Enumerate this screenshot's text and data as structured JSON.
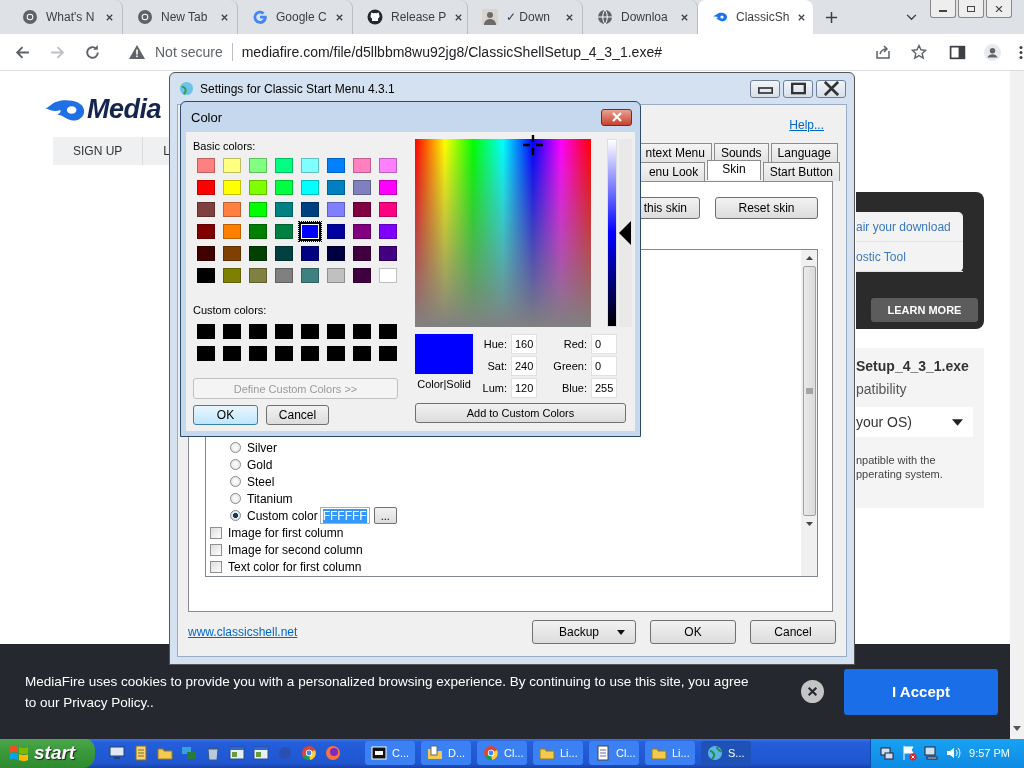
{
  "browser": {
    "tabs": [
      {
        "kind": "chrome",
        "title": "What's N",
        "selected": false
      },
      {
        "kind": "chrome",
        "title": "New Tab",
        "selected": false
      },
      {
        "kind": "g",
        "title": "Google C",
        "selected": false
      },
      {
        "kind": "github",
        "title": "Release P",
        "selected": false
      },
      {
        "kind": "avatar",
        "title": "✓ Down",
        "selected": false
      },
      {
        "kind": "globe",
        "title": "Downloa",
        "selected": false
      },
      {
        "kind": "flame",
        "title": "ClassicSh",
        "selected": true
      }
    ],
    "security": "Not secure",
    "url": "mediafire.com/file/d5llbbm8wu92jg8/ClassicShellSetup_4_3_1.exe#"
  },
  "page": {
    "logo": "Media",
    "nav": [
      "SIGN UP",
      "L"
    ],
    "help_links": [
      "air your download",
      "ostic Tool"
    ],
    "learn_more": "LEARN MORE",
    "file_name": "Setup_4_3_1.exe",
    "compat_label": "patibility",
    "os_select": "your OS)",
    "note": [
      "npatible with the",
      "pperating system."
    ],
    "cookie_text": "MediaFire uses cookies to provide you with a personalized browsing experience. By continuing to use this site, you agree to our Privacy Policy..",
    "cookie_button": "I Accept"
  },
  "settings_dialog": {
    "title": "Settings for Classic Start Menu 4.3.1",
    "help": "Help...",
    "tab_rows": [
      [
        {
          "label": "ntext Menu",
          "selected": false
        },
        {
          "label": "Sounds",
          "selected": false
        },
        {
          "label": "Language",
          "selected": false
        }
      ],
      [
        {
          "label": "enu Look",
          "selected": false
        },
        {
          "label": "Skin",
          "selected": true
        },
        {
          "label": "Start Button",
          "selected": false
        }
      ]
    ],
    "skin_buttons": [
      "this skin",
      "Reset skin"
    ],
    "options": [
      {
        "kind": "radio",
        "label": "Silver",
        "selected": false
      },
      {
        "kind": "radio",
        "label": "Gold",
        "selected": false
      },
      {
        "kind": "radio",
        "label": "Steel",
        "selected": false
      },
      {
        "kind": "radio",
        "label": "Titanium",
        "selected": false
      },
      {
        "kind": "radio",
        "label": "Custom color",
        "selected": true,
        "value": "FFFFFF",
        "button": "..."
      },
      {
        "kind": "checkbox",
        "label": "Image for first column",
        "checked": false
      },
      {
        "kind": "checkbox",
        "label": "Image for second column",
        "checked": false
      },
      {
        "kind": "checkbox",
        "label": "Text color for first column",
        "checked": false
      }
    ],
    "link": "www.classicshell.net",
    "buttons": [
      {
        "label": "Backup",
        "dropdown": true
      },
      {
        "label": "OK",
        "dropdown": false
      },
      {
        "label": "Cancel",
        "dropdown": false
      }
    ]
  },
  "color_dialog": {
    "title": "Color",
    "basic_label": "Basic colors:",
    "basic_colors": [
      {
        "color": "#ff8080",
        "selected": false
      },
      {
        "color": "#ffff80",
        "selected": false
      },
      {
        "color": "#80ff80",
        "selected": false
      },
      {
        "color": "#00ff80",
        "selected": false
      },
      {
        "color": "#80ffff",
        "selected": false
      },
      {
        "color": "#0080ff",
        "selected": false
      },
      {
        "color": "#ff80c0",
        "selected": false
      },
      {
        "color": "#ff80ff",
        "selected": false
      },
      {
        "color": "#ff0000",
        "selected": false
      },
      {
        "color": "#ffff00",
        "selected": false
      },
      {
        "color": "#80ff00",
        "selected": false
      },
      {
        "color": "#00ff40",
        "selected": false
      },
      {
        "color": "#00ffff",
        "selected": false
      },
      {
        "color": "#0080c0",
        "selected": false
      },
      {
        "color": "#8080c0",
        "selected": false
      },
      {
        "color": "#ff00ff",
        "selected": false
      },
      {
        "color": "#804040",
        "selected": false
      },
      {
        "color": "#ff8040",
        "selected": false
      },
      {
        "color": "#00ff00",
        "selected": false
      },
      {
        "color": "#008080",
        "selected": false
      },
      {
        "color": "#004080",
        "selected": false
      },
      {
        "color": "#8080ff",
        "selected": false
      },
      {
        "color": "#800040",
        "selected": false
      },
      {
        "color": "#ff0080",
        "selected": false
      },
      {
        "color": "#800000",
        "selected": false
      },
      {
        "color": "#ff8000",
        "selected": false
      },
      {
        "color": "#008000",
        "selected": false
      },
      {
        "color": "#008040",
        "selected": false
      },
      {
        "color": "#0000ff",
        "selected": true
      },
      {
        "color": "#0000a0",
        "selected": false
      },
      {
        "color": "#800080",
        "selected": false
      },
      {
        "color": "#8000ff",
        "selected": false
      },
      {
        "color": "#400000",
        "selected": false
      },
      {
        "color": "#804000",
        "selected": false
      },
      {
        "color": "#004000",
        "selected": false
      },
      {
        "color": "#004040",
        "selected": false
      },
      {
        "color": "#000080",
        "selected": false
      },
      {
        "color": "#000040",
        "selected": false
      },
      {
        "color": "#400040",
        "selected": false
      },
      {
        "color": "#400080",
        "selected": false
      },
      {
        "color": "#000000",
        "selected": false
      },
      {
        "color": "#808000",
        "selected": false
      },
      {
        "color": "#808040",
        "selected": false
      },
      {
        "color": "#808080",
        "selected": false
      },
      {
        "color": "#408080",
        "selected": false
      },
      {
        "color": "#c0c0c0",
        "selected": false
      },
      {
        "color": "#400040",
        "selected": false
      },
      {
        "color": "#ffffff",
        "selected": false
      }
    ],
    "custom_label": "Custom colors:",
    "custom_colors": [
      {
        "color": "#000000"
      },
      {
        "color": "#000000"
      },
      {
        "color": "#000000"
      },
      {
        "color": "#000000"
      },
      {
        "color": "#000000"
      },
      {
        "color": "#000000"
      },
      {
        "color": "#000000"
      },
      {
        "color": "#000000"
      },
      {
        "color": "#000000"
      },
      {
        "color": "#000000"
      },
      {
        "color": "#000000"
      },
      {
        "color": "#000000"
      },
      {
        "color": "#000000"
      },
      {
        "color": "#000000"
      },
      {
        "color": "#000000"
      },
      {
        "color": "#000000"
      }
    ],
    "define_button": {
      "label": "Define Custom Colors >>",
      "disabled": true
    },
    "ok": "OK",
    "cancel": "Cancel",
    "preview": {
      "color": "#0000ff",
      "label": "Color|Solid"
    },
    "lum_slider": {
      "level": 0.5
    },
    "hsl": [
      {
        "label": "Hue:",
        "value": "160"
      },
      {
        "label": "Sat:",
        "value": "240"
      },
      {
        "label": "Lum:",
        "value": "120"
      }
    ],
    "rgb": [
      {
        "label": "Red:",
        "value": "0"
      },
      {
        "label": "Green:",
        "value": "0"
      },
      {
        "label": "Blue:",
        "value": "255"
      }
    ],
    "add_button": "Add to Custom Colors"
  },
  "taskbar": {
    "start": "start",
    "tasks": [
      {
        "kind": "archive",
        "label": "C...",
        "selected": false
      },
      {
        "kind": "document",
        "label": "D...",
        "selected": false
      },
      {
        "kind": "browser",
        "label": "Cl...",
        "selected": false
      },
      {
        "kind": "folder",
        "label": "Li...",
        "selected": false
      },
      {
        "kind": "notepad",
        "label": "Cl...",
        "selected": false
      },
      {
        "kind": "folder",
        "label": "Li...",
        "selected": false
      },
      {
        "kind": "globe",
        "label": "S...",
        "selected": true
      }
    ],
    "clock": "9:57 PM"
  }
}
